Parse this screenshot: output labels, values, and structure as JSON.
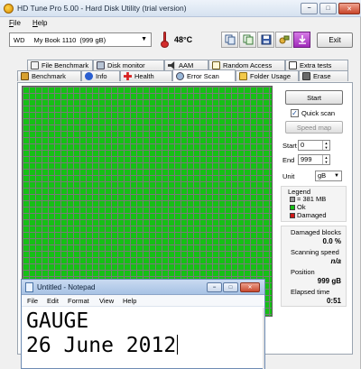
{
  "window": {
    "title": "HD Tune Pro 5.00 - Hard Disk Utility (trial version)",
    "controls": {
      "minimize": "−",
      "maximize": "□",
      "close": "✕"
    }
  },
  "menu": [
    {
      "label": "File",
      "mnemonic": "F",
      "rest": "ile"
    },
    {
      "label": "Help",
      "mnemonic": "H",
      "rest": "elp"
    }
  ],
  "toolbar": {
    "drive_vendor": "WD",
    "drive_name": "My Book 1110",
    "drive_size": "(999 gB)",
    "temperature": "48°C",
    "exit_label": "Exit",
    "icons": [
      "copy-icon",
      "copy-all-icon",
      "save-icon",
      "options-icon",
      "download-icon"
    ]
  },
  "tabs_row1": [
    {
      "label": "File Benchmark"
    },
    {
      "label": "Disk monitor"
    },
    {
      "label": "AAM"
    },
    {
      "label": "Random Access"
    },
    {
      "label": "Extra tests"
    }
  ],
  "tabs_row2": [
    {
      "label": "Benchmark"
    },
    {
      "label": "Info"
    },
    {
      "label": "Health"
    },
    {
      "label": "Error Scan",
      "active": true
    },
    {
      "label": "Folder Usage"
    },
    {
      "label": "Erase"
    }
  ],
  "error_scan": {
    "start_button": "Start",
    "quick_scan_label": "Quick scan",
    "quick_scan_checked": true,
    "speed_map_button": "Speed map",
    "start_label": "Start",
    "start_value": "0",
    "end_label": "End",
    "end_value": "999",
    "unit_label": "Unit",
    "unit_value": "gB",
    "legend": {
      "title": "Legend",
      "block_size": "= 381 MB",
      "ok": "Ok",
      "damaged": "Damaged"
    },
    "damaged_blocks_label": "Damaged blocks",
    "damaged_blocks_value": "0.0 %",
    "scanning_speed_label": "Scanning speed",
    "scanning_speed_value": "n/a",
    "position_label": "Position",
    "position_value": "999 gB",
    "elapsed_time_label": "Elapsed time",
    "elapsed_time_value": "0:51",
    "colors": {
      "ok": "#15c015",
      "damaged": "#d01818",
      "grid": "#7a7a7a"
    }
  },
  "notepad": {
    "title": "Untitled - Notepad",
    "menu": [
      "File",
      "Edit",
      "Format",
      "View",
      "Help"
    ],
    "line1": "GAUGE",
    "line2": "26 June 2012"
  }
}
